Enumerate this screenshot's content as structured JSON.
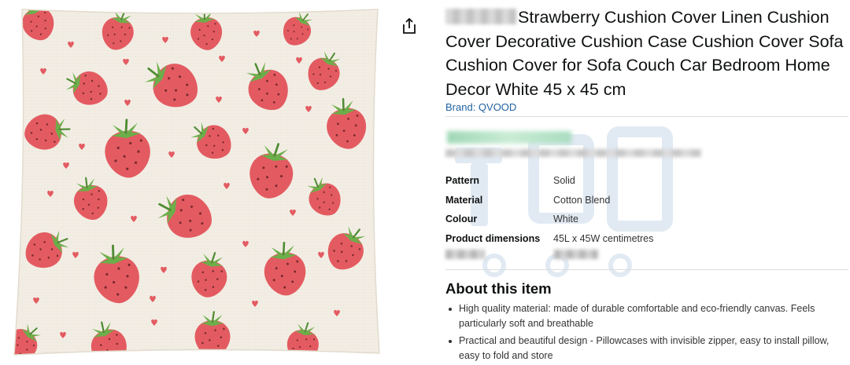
{
  "product": {
    "title": "Strawberry Cushion Cover Linen Cushion Cover Decorative Cushion Case Cushion Cover Sofa Cushion Cover for Sofa Couch Car Bedroom Home Decor White 45 x 45 cm",
    "brand": "Brand: QVOOD"
  },
  "specs": [
    {
      "label": "Pattern",
      "value": "Solid"
    },
    {
      "label": "Material",
      "value": "Cotton Blend"
    },
    {
      "label": "Colour",
      "value": "White"
    },
    {
      "label": "Product dimensions",
      "value": "45L x 45W centimetres"
    }
  ],
  "about": {
    "heading": "About this item",
    "bullets": [
      "High quality material: made of durable comfortable and eco-friendly canvas. Feels particularly soft and breathable",
      "Practical and beautiful design - Pillowcases with invisible zipper, easy to install pillow, easy to fold and store"
    ]
  },
  "icons": {
    "share": "share-icon"
  },
  "colors": {
    "brand_link": "#2162a1",
    "pillow_fabric": "#f4efe6",
    "strawberry": "#e05a5f",
    "leaf": "#6cae4a"
  }
}
